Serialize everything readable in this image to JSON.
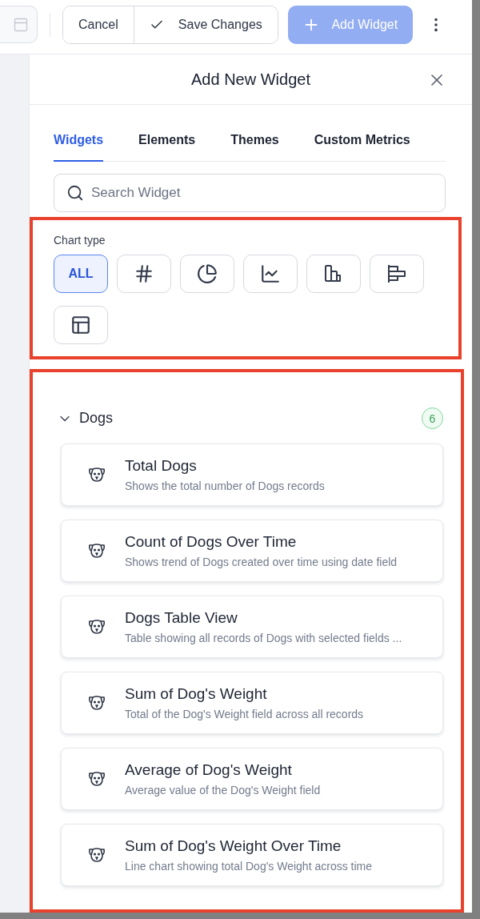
{
  "toolbar": {
    "cancel": "Cancel",
    "save": "Save Changes",
    "add": {
      "label": "Add Widget",
      "disabled": true
    }
  },
  "panel": {
    "title": "Add New Widget",
    "tabs": [
      {
        "label": "Widgets",
        "selected": true
      },
      {
        "label": "Elements",
        "selected": false
      },
      {
        "label": "Themes",
        "selected": false
      },
      {
        "label": "Custom Metrics",
        "selected": false
      }
    ],
    "search": {
      "placeholder": "Search Widget"
    },
    "chart_type": {
      "label": "Chart type",
      "options": [
        {
          "kind": "all",
          "text": "ALL",
          "selected": true
        },
        {
          "kind": "number",
          "selected": false
        },
        {
          "kind": "pie",
          "selected": false
        },
        {
          "kind": "line",
          "selected": false
        },
        {
          "kind": "bar",
          "selected": false
        },
        {
          "kind": "hbar",
          "selected": false
        },
        {
          "kind": "table",
          "selected": false
        }
      ]
    },
    "group": {
      "name": "Dogs",
      "count": "6",
      "expanded": true,
      "items": [
        {
          "title": "Total Dogs",
          "description": "Shows the total number of Dogs records"
        },
        {
          "title": "Count of Dogs Over Time",
          "description": "Shows trend of Dogs created over time using date field"
        },
        {
          "title": "Dogs Table View",
          "description": "Table showing all records of Dogs with selected fields ..."
        },
        {
          "title": "Sum of Dog's Weight",
          "description": "Total of the Dog's Weight field across all records"
        },
        {
          "title": "Average of Dog's Weight",
          "description": "Average value of the Dog's Weight field"
        },
        {
          "title": "Sum of Dog's Weight Over Time",
          "description": "Line chart showing total Dog's Weight across time"
        }
      ]
    }
  }
}
